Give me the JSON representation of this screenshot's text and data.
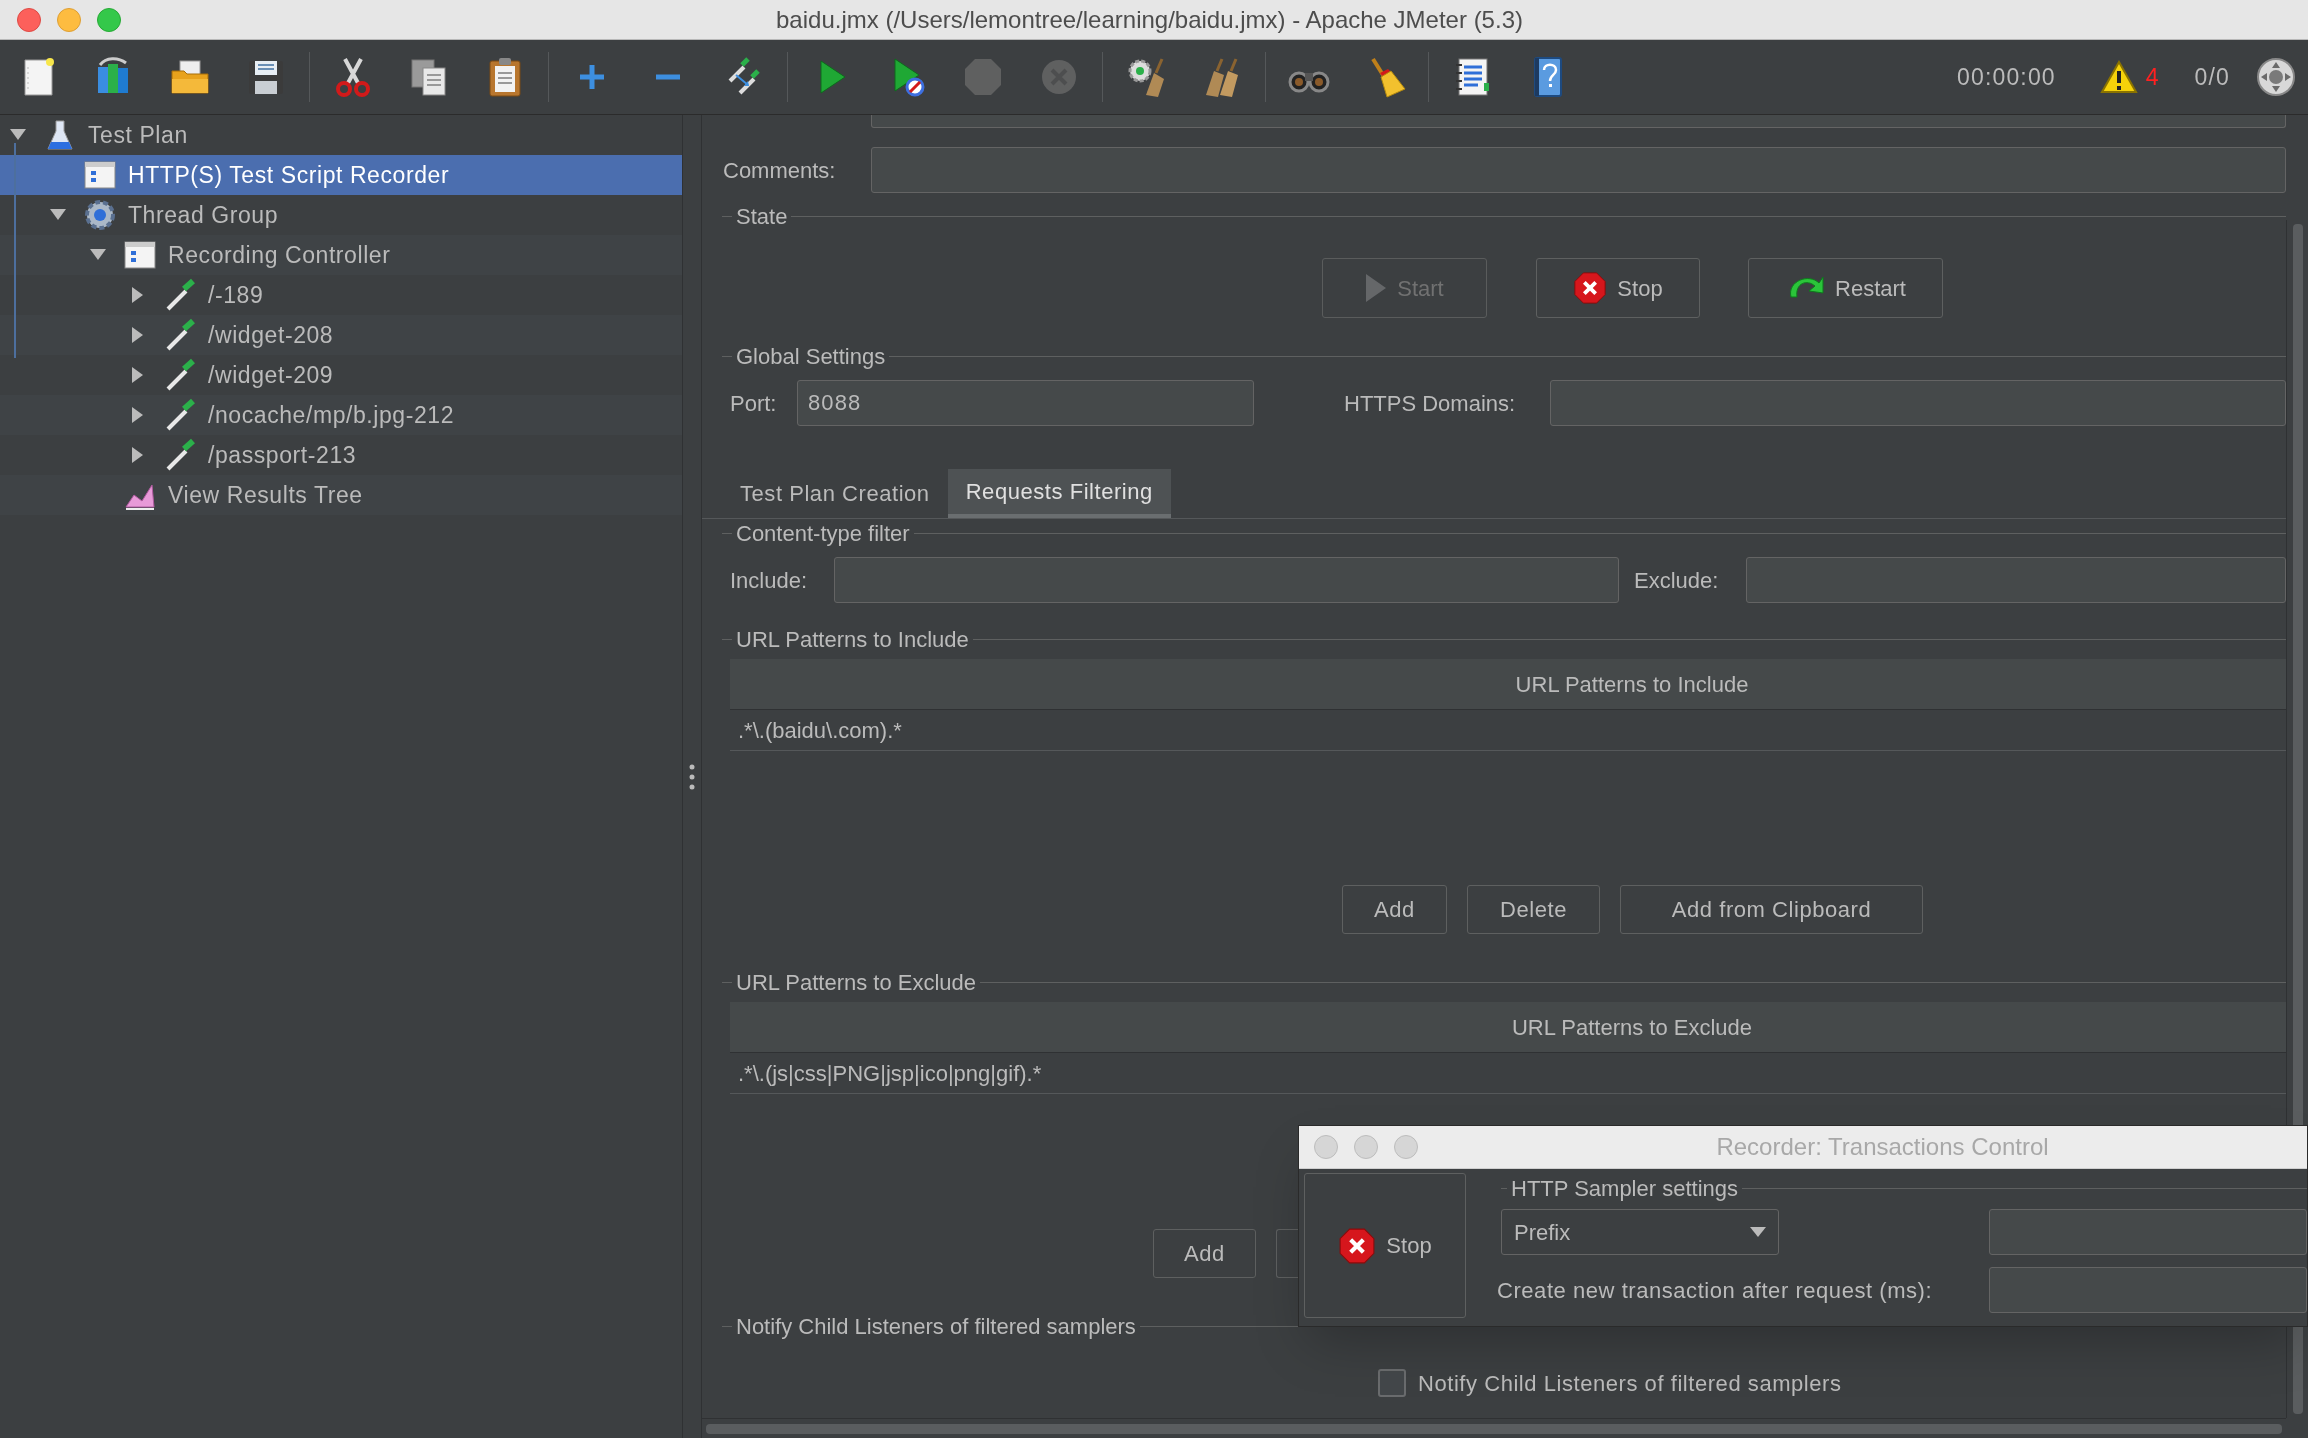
{
  "window": {
    "title": "baidu.jmx (/Users/lemontree/learning/baidu.jmx) - Apache JMeter (5.3)"
  },
  "toolbar": [
    {
      "kind": "new",
      "disabled": false
    },
    {
      "kind": "templates",
      "disabled": false
    },
    {
      "kind": "open",
      "disabled": false
    },
    {
      "kind": "save",
      "disabled": false
    },
    {
      "kind": "separator"
    },
    {
      "kind": "cut",
      "disabled": false
    },
    {
      "kind": "copy",
      "disabled": false
    },
    {
      "kind": "paste",
      "disabled": false
    },
    {
      "kind": "separator"
    },
    {
      "kind": "expand",
      "disabled": false
    },
    {
      "kind": "collapse",
      "disabled": false
    },
    {
      "kind": "toggle",
      "disabled": false
    },
    {
      "kind": "separator"
    },
    {
      "kind": "start",
      "disabled": false
    },
    {
      "kind": "start_no_pauses",
      "disabled": false
    },
    {
      "kind": "stop",
      "disabled": true
    },
    {
      "kind": "shutdown",
      "disabled": true
    },
    {
      "kind": "separator"
    },
    {
      "kind": "clear",
      "disabled": false
    },
    {
      "kind": "clear_all",
      "disabled": false
    },
    {
      "kind": "separator"
    },
    {
      "kind": "search",
      "disabled": false
    },
    {
      "kind": "reset_search",
      "disabled": false
    },
    {
      "kind": "separator"
    },
    {
      "kind": "function_helper",
      "disabled": false
    },
    {
      "kind": "help",
      "disabled": false
    }
  ],
  "status": {
    "timer": "00:00:00",
    "warning_count": "4",
    "threads": "0/0"
  },
  "tree": [
    {
      "label": "Test Plan",
      "kind": "test_plan",
      "selected": false,
      "expanded": true,
      "children": [
        {
          "label": "HTTP(S) Test Script Recorder",
          "kind": "recorder",
          "selected": true
        },
        {
          "label": "Thread Group",
          "kind": "thread_group",
          "selected": false,
          "expanded": true,
          "children": [
            {
              "label": "Recording Controller",
              "kind": "controller",
              "selected": false,
              "expanded": true,
              "children": [
                {
                  "label": "/-189",
                  "kind": "sampler",
                  "selected": false,
                  "expanded": false
                },
                {
                  "label": "/widget-208",
                  "kind": "sampler",
                  "selected": false,
                  "expanded": false
                },
                {
                  "label": "/widget-209",
                  "kind": "sampler",
                  "selected": false,
                  "expanded": false
                },
                {
                  "label": "/nocache/mp/b.jpg-212",
                  "kind": "sampler",
                  "selected": false,
                  "expanded": false
                },
                {
                  "label": "/passport-213",
                  "kind": "sampler",
                  "selected": false,
                  "expanded": false
                }
              ]
            },
            {
              "label": "View Results Tree",
              "kind": "listener",
              "selected": false
            }
          ]
        }
      ]
    }
  ],
  "form": {
    "comments": {
      "label": "Comments:"
    },
    "state": {
      "title": "State",
      "buttons": [
        {
          "label": "Start",
          "kind": "start",
          "disabled": true
        },
        {
          "label": "Stop",
          "kind": "stop",
          "disabled": false
        },
        {
          "label": "Restart",
          "kind": "restart",
          "disabled": false
        }
      ]
    },
    "global_settings": {
      "title": "Global Settings",
      "port": {
        "label": "Port:",
        "value": "8088"
      },
      "https_domains": {
        "label": "HTTPS Domains:"
      }
    },
    "tabs": [
      {
        "label": "Test Plan Creation",
        "selected": false
      },
      {
        "label": "Requests Filtering",
        "selected": true
      }
    ],
    "content_type_filter": {
      "title": "Content-type filter",
      "include": {
        "label": "Include:"
      },
      "exclude": {
        "label": "Exclude:"
      }
    },
    "include_patterns": {
      "title": "URL Patterns to Include",
      "column": "URL Patterns to Include",
      "rows": [
        ".*\\.(baidu\\.com).*"
      ],
      "buttons": [
        "Add",
        "Delete",
        "Add from Clipboard"
      ]
    },
    "exclude_patterns": {
      "title": "URL Patterns to Exclude",
      "column": "URL Patterns to Exclude",
      "rows": [
        ".*\\.(js|css|PNG|jsp|ico|png|gif).*"
      ],
      "buttons": [
        "Add"
      ]
    },
    "notify": {
      "title": "Notify Child Listeners of filtered samplers",
      "checkbox": {
        "label": "Notify Child Listeners of filtered samplers",
        "checked": false
      }
    }
  },
  "recorder_dialog": {
    "title": "Recorder: Transactions Control",
    "stop_button": "Stop",
    "group_title": "HTTP Sampler settings",
    "naming": {
      "value": "Prefix"
    },
    "transaction_label": "Create new transaction after request (ms):"
  }
}
